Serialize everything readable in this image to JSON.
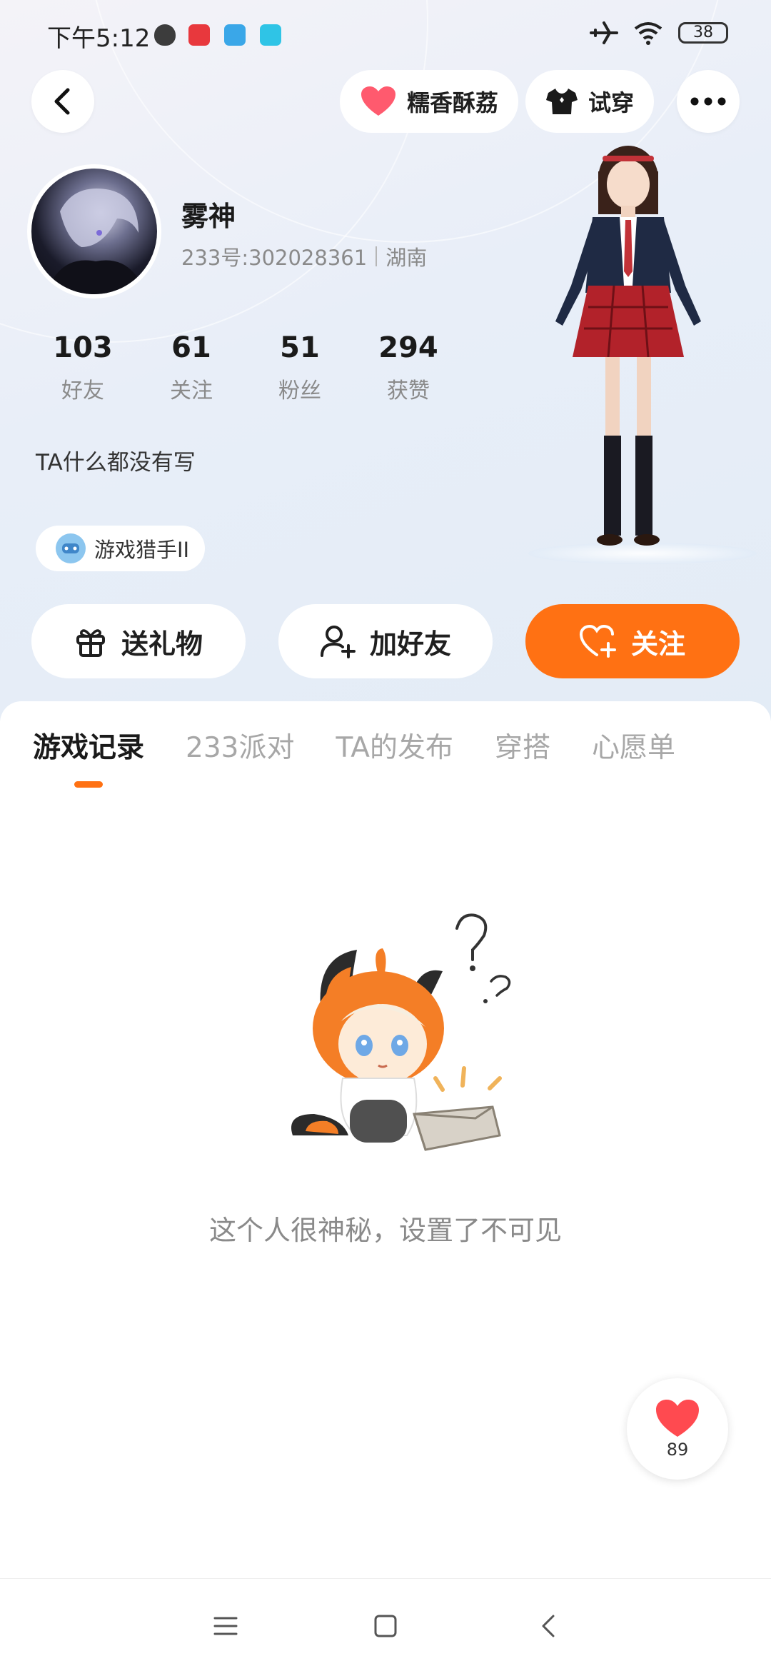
{
  "status_bar": {
    "time": "下午5:12",
    "battery": "38",
    "icons": [
      "shield-icon",
      "app-red-icon",
      "app-blue-icon",
      "app-cyan-icon",
      "airplane-icon",
      "wifi-icon",
      "battery-icon"
    ]
  },
  "top_nav": {
    "back_icon": "chevron-left-icon",
    "couple_label": "糯香酥荔",
    "try_on_label": "试穿",
    "more_icon": "more-dots-icon"
  },
  "profile": {
    "nickname": "雾神",
    "uid": "233号:302028361",
    "location": "湖南",
    "bio": "TA什么都没有写",
    "badge": "游戏猎手II",
    "stats": [
      {
        "value": "103",
        "label": "好友"
      },
      {
        "value": "61",
        "label": "关注"
      },
      {
        "value": "51",
        "label": "粉丝"
      },
      {
        "value": "294",
        "label": "获赞"
      }
    ]
  },
  "actions": {
    "gift": "送礼物",
    "add_friend": "加好友",
    "follow": "关注"
  },
  "tabs": [
    "游戏记录",
    "233派对",
    "TA的发布",
    "穿搭",
    "心愿单"
  ],
  "active_tab": 0,
  "empty_state": {
    "message": "这个人很神秘，设置了不可见"
  },
  "like_fab": {
    "count": "89"
  },
  "colors": {
    "accent": "#ff7113",
    "heart": "#ff5a6e",
    "text_primary": "#1a1a1a",
    "text_secondary": "#8a8a8a"
  }
}
